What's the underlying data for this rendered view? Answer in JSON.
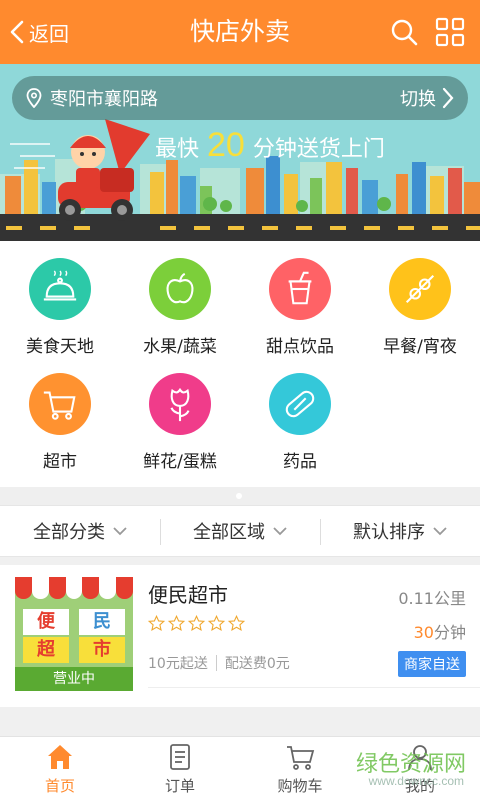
{
  "colors": {
    "brand": "#ff8a2e",
    "accent_yellow": "#f8df3a",
    "badge_blue": "#3f8ff0",
    "open_green": "#5aaa32"
  },
  "header": {
    "back_label": "返回",
    "title": "快店外卖",
    "icons": [
      "search-icon",
      "grid-menu-icon"
    ]
  },
  "banner": {
    "location": "枣阳市襄阳路",
    "switch_label": "切换",
    "slogan_pre": "最快",
    "slogan_minutes": "20",
    "slogan_post": "分钟送货上门"
  },
  "categories": [
    {
      "label": "美食天地",
      "icon": "food-cloche-icon",
      "color": "#2cc9a8"
    },
    {
      "label": "水果/蔬菜",
      "icon": "apple-icon",
      "color": "#7ccf3a"
    },
    {
      "label": "甜点饮品",
      "icon": "drink-cup-icon",
      "color": "#ff6266"
    },
    {
      "label": "早餐/宵夜",
      "icon": "skewer-icon",
      "color": "#ffc21a"
    },
    {
      "label": "超市",
      "icon": "shopping-cart-icon",
      "color": "#ff9230"
    },
    {
      "label": "鲜花/蛋糕",
      "icon": "rose-icon",
      "color": "#f03c8a"
    },
    {
      "label": "药品",
      "icon": "pill-icon",
      "color": "#34c8d9"
    }
  ],
  "filters": [
    {
      "label": "全部分类"
    },
    {
      "label": "全部区域"
    },
    {
      "label": "默认排序"
    }
  ],
  "shop": {
    "name": "便民超市",
    "image_signs": [
      "便",
      "民",
      "超",
      "市"
    ],
    "status": "营业中",
    "rating_stars": 0,
    "rating_max": 5,
    "min_order": "10元起送",
    "delivery_fee": "配送费0元",
    "distance": "0.11公里",
    "eta_num": "30",
    "eta_unit": "分钟",
    "delivery_type": "商家自送"
  },
  "tabbar": [
    {
      "label": "首页",
      "icon": "home-icon",
      "active": true
    },
    {
      "label": "订单",
      "icon": "order-list-icon",
      "active": false
    },
    {
      "label": "购物车",
      "icon": "cart-icon",
      "active": false
    },
    {
      "label": "我的",
      "icon": "user-icon",
      "active": false
    }
  ],
  "watermark": {
    "main": "绿色资源网",
    "sub": "www.downcc.com"
  }
}
